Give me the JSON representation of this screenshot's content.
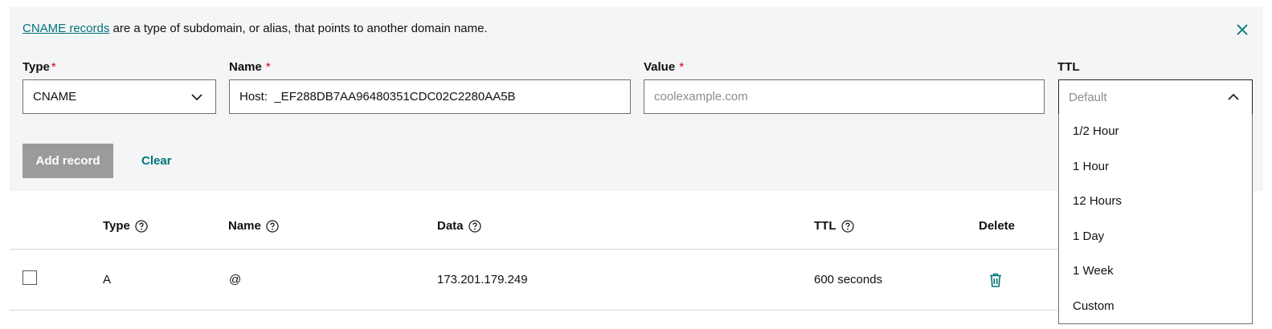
{
  "info": {
    "link_text": "CNAME records",
    "text": " are a type of subdomain, or alias, that points to another domain name."
  },
  "icons": {
    "close": "close-icon",
    "chevron_down": "chevron-down-icon",
    "chevron_up": "chevron-up-icon",
    "help": "question-circle-icon",
    "trash": "trash-icon"
  },
  "form": {
    "type": {
      "label": "Type",
      "required": "*",
      "value": "CNAME"
    },
    "name": {
      "label": "Name",
      "required": "*",
      "value": "Host:  _EF288DB7AA96480351CDC02C2280AA5B"
    },
    "value": {
      "label": "Value",
      "required": "*",
      "placeholder": "coolexample.com"
    },
    "ttl": {
      "label": "TTL",
      "placeholder": "Default"
    },
    "add_button": "Add record",
    "clear_button": "Clear"
  },
  "ttl_options": [
    "1/2 Hour",
    "1 Hour",
    "12 Hours",
    "1 Day",
    "1 Week",
    "Custom"
  ],
  "table": {
    "headers": {
      "type": "Type",
      "name": "Name",
      "data": "Data",
      "ttl": "TTL",
      "delete": "Delete"
    },
    "rows": [
      {
        "type": "A",
        "name": "@",
        "data": "173.201.179.249",
        "ttl": "600 seconds"
      }
    ]
  },
  "colors": {
    "accent": "#00737a",
    "required": "#d6001c",
    "panel_bg": "#f4f5f6",
    "disabled_button": "#9b9b9b"
  }
}
